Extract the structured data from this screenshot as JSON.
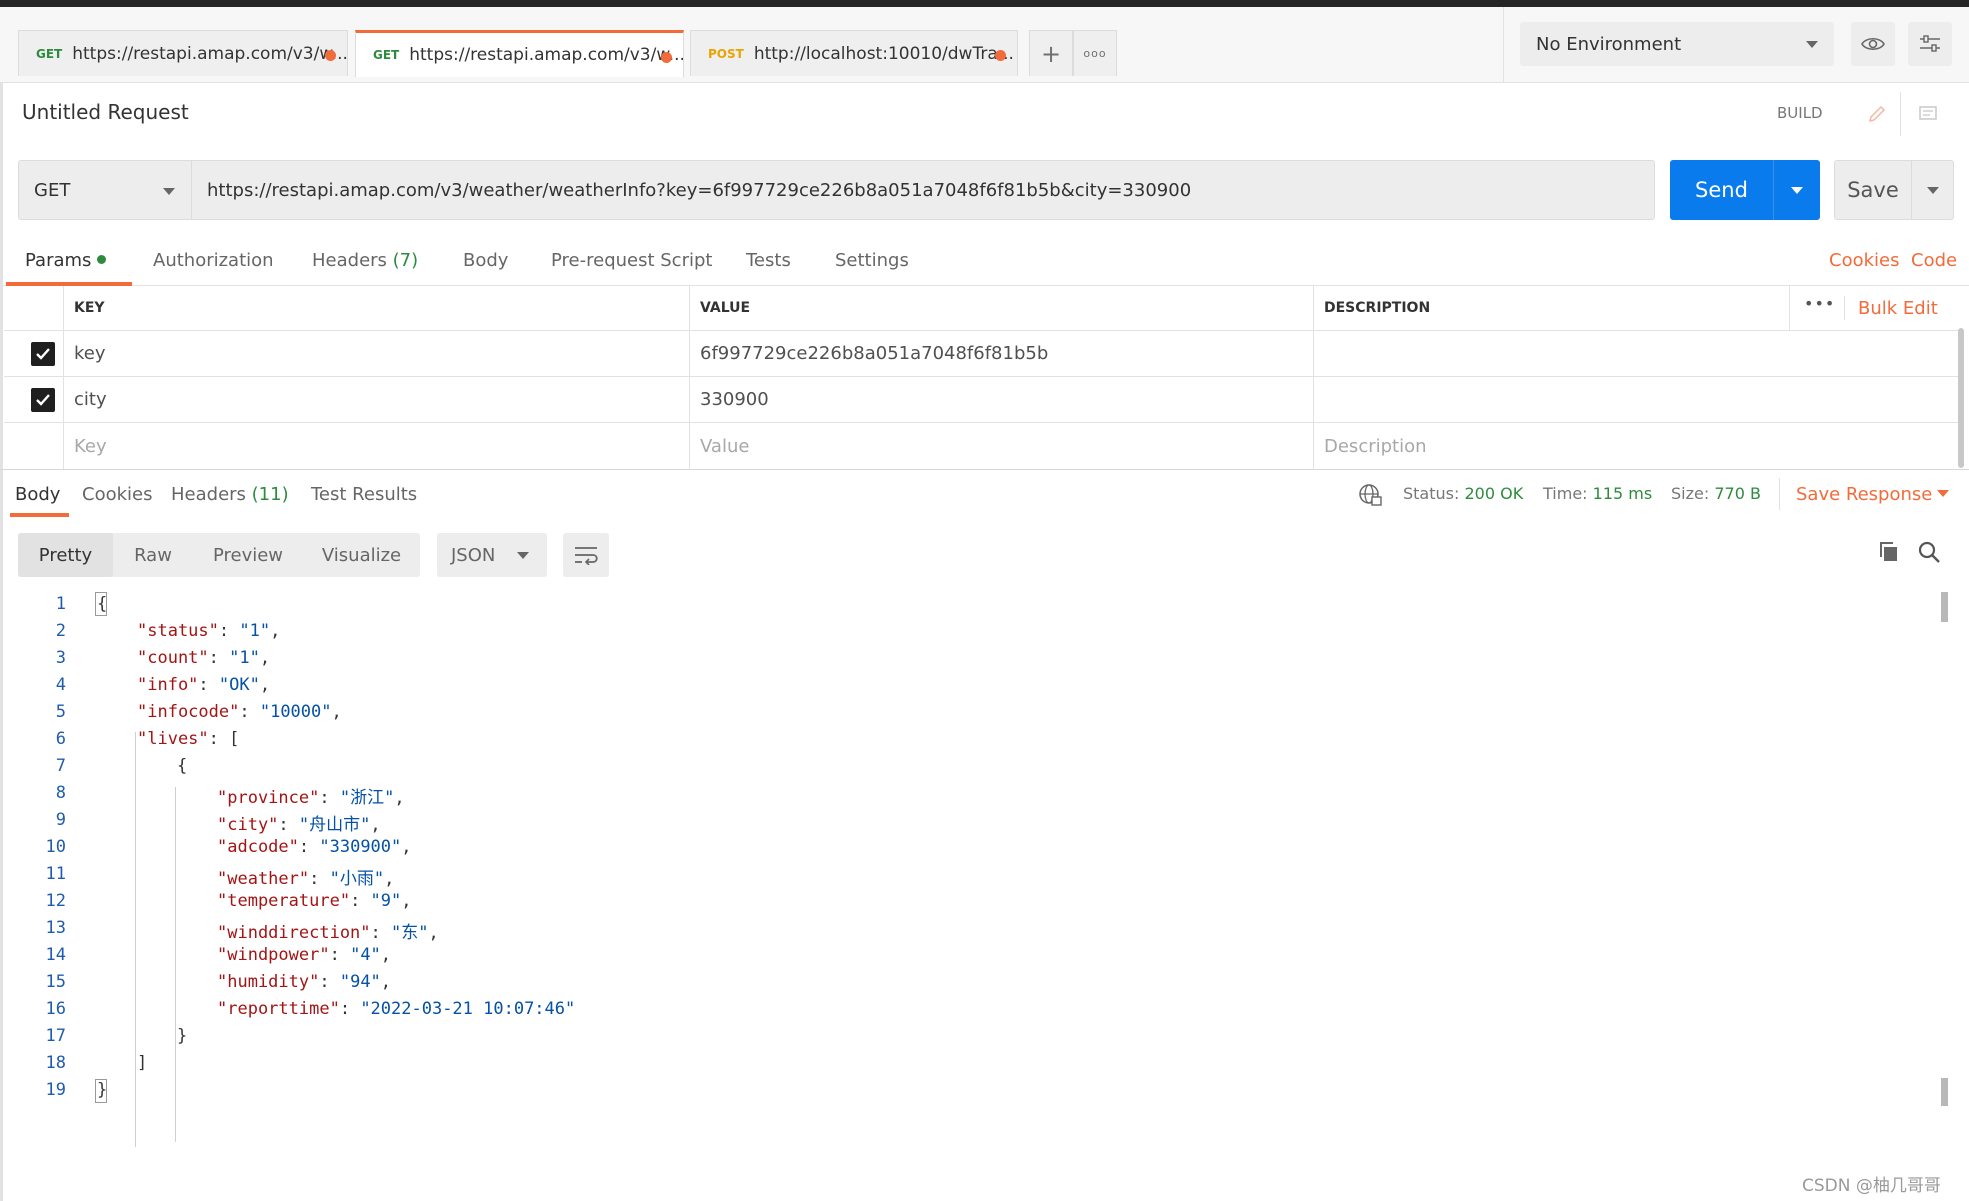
{
  "tabs": [
    {
      "method": "GET",
      "url": "https://restapi.amap.com/v3/w..."
    },
    {
      "method": "GET",
      "url": "https://restapi.amap.com/v3/w..."
    },
    {
      "method": "POST",
      "url": "http://localhost:10010/dwTra..."
    }
  ],
  "tab_actions": {
    "add": "+",
    "more": "ooo"
  },
  "environment": {
    "selected": "No Environment"
  },
  "request": {
    "title": "Untitled Request",
    "mode": "BUILD",
    "method": "GET",
    "url": "https://restapi.amap.com/v3/weather/weatherInfo?key=6f997729ce226b8a051a7048f6f81b5b&city=330900",
    "send_label": "Send",
    "save_label": "Save"
  },
  "request_tabs": {
    "params": "Params",
    "authorization": "Authorization",
    "headers": "Headers",
    "headers_count": "(7)",
    "body": "Body",
    "pre_request": "Pre-request Script",
    "tests": "Tests",
    "settings": "Settings",
    "cookies_link": "Cookies",
    "code_link": "Code"
  },
  "params": {
    "columns": {
      "key": "KEY",
      "value": "VALUE",
      "description": "DESCRIPTION"
    },
    "bulk_edit": "Bulk Edit",
    "more": "•••",
    "rows": [
      {
        "key": "key",
        "value": "6f997729ce226b8a051a7048f6f81b5b",
        "description": ""
      },
      {
        "key": "city",
        "value": "330900",
        "description": ""
      }
    ],
    "placeholders": {
      "key": "Key",
      "value": "Value",
      "description": "Description"
    }
  },
  "response_tabs": {
    "body": "Body",
    "cookies": "Cookies",
    "headers": "Headers",
    "headers_count": "(11)",
    "test_results": "Test Results"
  },
  "response_meta": {
    "status_label": "Status:",
    "status": "200 OK",
    "time_label": "Time:",
    "time": "115 ms",
    "size_label": "Size:",
    "size": "770 B",
    "save_response": "Save Response"
  },
  "response_toolbar": {
    "formats": [
      "Pretty",
      "Raw",
      "Preview",
      "Visualize"
    ],
    "active_format": "Pretty",
    "language": "JSON"
  },
  "code_lines": [
    {
      "n": "1",
      "text": "{"
    },
    {
      "n": "2",
      "key": "\"status\"",
      "val": "\"1\"",
      "tail": ","
    },
    {
      "n": "3",
      "key": "\"count\"",
      "val": "\"1\"",
      "tail": ","
    },
    {
      "n": "4",
      "key": "\"info\"",
      "val": "\"OK\"",
      "tail": ","
    },
    {
      "n": "5",
      "key": "\"infocode\"",
      "val": "\"10000\"",
      "tail": ","
    },
    {
      "n": "6",
      "key": "\"lives\"",
      "val": "[",
      "tail": ""
    },
    {
      "n": "7",
      "text": "{"
    },
    {
      "n": "8",
      "key": "\"province\"",
      "val": "\"浙江\"",
      "tail": ","
    },
    {
      "n": "9",
      "key": "\"city\"",
      "val": "\"舟山市\"",
      "tail": ","
    },
    {
      "n": "10",
      "key": "\"adcode\"",
      "val": "\"330900\"",
      "tail": ","
    },
    {
      "n": "11",
      "key": "\"weather\"",
      "val": "\"小雨\"",
      "tail": ","
    },
    {
      "n": "12",
      "key": "\"temperature\"",
      "val": "\"9\"",
      "tail": ","
    },
    {
      "n": "13",
      "key": "\"winddirection\"",
      "val": "\"东\"",
      "tail": ","
    },
    {
      "n": "14",
      "key": "\"windpower\"",
      "val": "\"4\"",
      "tail": ","
    },
    {
      "n": "15",
      "key": "\"humidity\"",
      "val": "\"94\"",
      "tail": ","
    },
    {
      "n": "16",
      "key": "\"reporttime\"",
      "val": "\"2022-03-21 10:07:46\"",
      "tail": ""
    },
    {
      "n": "17",
      "text": "}"
    },
    {
      "n": "18",
      "text": "]"
    },
    {
      "n": "19",
      "text": "}"
    }
  ],
  "watermark": "CSDN @柚几哥哥",
  "colors": {
    "accent": "#f26b3a",
    "send": "#097bed",
    "success": "#2e8b3e"
  }
}
